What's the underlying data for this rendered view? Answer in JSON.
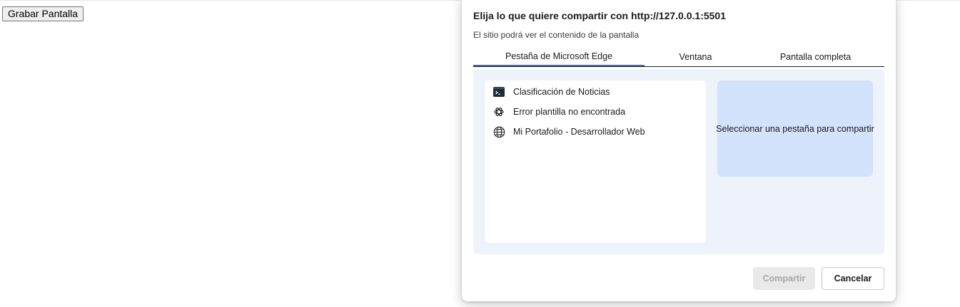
{
  "page": {
    "record_button_label": "Grabar Pantalla"
  },
  "dialog": {
    "title": "Elija lo que quiere compartir con http://127.0.0.1:5501",
    "subtitle": "El sitio podrá ver el contenido de la pantalla",
    "tabs": [
      {
        "label": "Pestaña de Microsoft Edge",
        "selected": true
      },
      {
        "label": "Ventana",
        "selected": false
      },
      {
        "label": "Pantalla completa",
        "selected": false
      }
    ],
    "browser_tabs": [
      {
        "label": "Clasificación de Noticias",
        "icon": "terminal-icon"
      },
      {
        "label": "Error plantilla no encontrada",
        "icon": "openai-icon"
      },
      {
        "label": "Mi Portafolio - Desarrollador Web",
        "icon": "globe-icon"
      }
    ],
    "preview_text": "Seleccionar una pestaña para compartir",
    "share_button_label": "Compartir",
    "share_button_enabled": false,
    "cancel_button_label": "Cancelar"
  },
  "colors": {
    "accent": "#2f6fc0",
    "panel_bg": "#eef2fa",
    "preview_bg": "#d3e3fb",
    "disabled_button_bg": "#e9e9e9"
  }
}
